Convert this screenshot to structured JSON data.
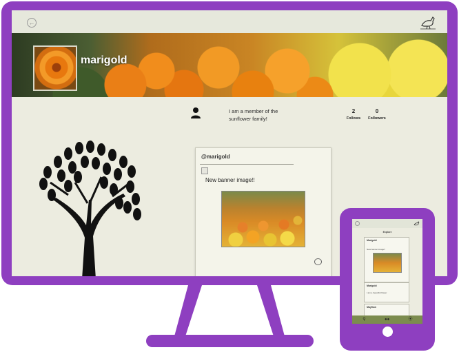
{
  "colors": {
    "device_frame": "#8e3fc0",
    "app_background": "#ecece0",
    "topbar": "#e6e8dc",
    "mobile_nav": "#7c8c4e"
  },
  "desktop": {
    "topbar": {
      "back_icon": "back-arrow-icon",
      "logo_icon": "bird-icon"
    },
    "profile": {
      "username": "marigold",
      "bio": "I am a member of the sunflower family!",
      "follows_count": "2",
      "follows_label": "Follows",
      "followers_count": "0",
      "followers_label": "Followers"
    },
    "post": {
      "user": "@marigold",
      "text": "New banner image!!",
      "comment_icon": "comment-icon"
    }
  },
  "mobile": {
    "title": "Explore",
    "cards": [
      {
        "user": "Marigold",
        "text": "New banner image!!"
      },
      {
        "user": "Marigold",
        "text": "I am a beautiful flower"
      },
      {
        "user": "Mayflow",
        "text": ""
      }
    ],
    "nav": [
      "search-icon",
      "people-icon",
      "compass-icon"
    ]
  }
}
